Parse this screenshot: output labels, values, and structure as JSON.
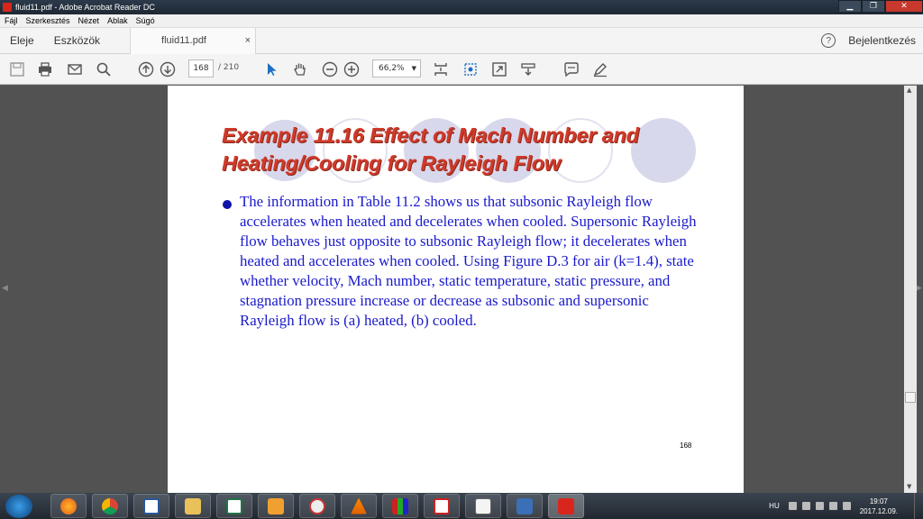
{
  "window": {
    "title": "fluid11.pdf - Adobe Acrobat Reader DC",
    "minimize": "▁",
    "maximize": "❐",
    "close": "✕"
  },
  "menu": [
    "Fájl",
    "Szerkesztés",
    "Nézet",
    "Ablak",
    "Súgó"
  ],
  "tabs": {
    "home": "Eleje",
    "tools": "Eszközök",
    "document": "fluid11.pdf",
    "close": "×",
    "help": "?",
    "signin": "Bejelentkezés"
  },
  "toolbar": {
    "page_current": "168",
    "page_total": "/ 210",
    "zoom": "66,2%",
    "zoom_arrow": "▼",
    "icons": [
      "save-icon",
      "print-icon",
      "email-icon",
      "search-icon",
      "page-up-icon",
      "page-down-icon",
      "select-cursor-icon",
      "hand-icon",
      "zoom-out-icon",
      "zoom-in-icon",
      "fit-page-icon",
      "rotate-icon",
      "full-screen-icon",
      "read-mode-icon",
      "comment-icon",
      "highlight-pen-icon"
    ]
  },
  "slide": {
    "title_line1": "Example 11.16 Effect of Mach Number and",
    "title_line2": "Heating/Cooling for Rayleigh Flow",
    "body": "The information in Table 11.2 shows us that subsonic Rayleigh flow accelerates when heated and decelerates when cooled. Supersonic Rayleigh flow behaves just opposite to subsonic Rayleigh flow; it decelerates when heated and accelerates when cooled. Using Figure D.3 for air (k=1.4), state whether velocity, Mach number, static temperature, static pressure, and stagnation pressure increase or decrease as subsonic and supersonic Rayleigh flow is (a) heated, (b) cooled.",
    "page_number": "168"
  },
  "scrollbar": {
    "up": "▲",
    "down": "▼"
  },
  "viewer": {
    "left_arrow": "◀",
    "right_arrow": "▶"
  },
  "taskbar": {
    "apps": [
      "firefox-icon",
      "chrome-icon",
      "word-icon",
      "explorer-icon",
      "excel-icon",
      "media-player-icon",
      "clock-app-icon",
      "vlc-icon",
      "colorbars-icon",
      "music-app-icon",
      "chart-app-icon",
      "wave-app-icon",
      "acrobat-icon"
    ],
    "lang": "HU",
    "time": "19:07",
    "date": "2017.12.09."
  }
}
